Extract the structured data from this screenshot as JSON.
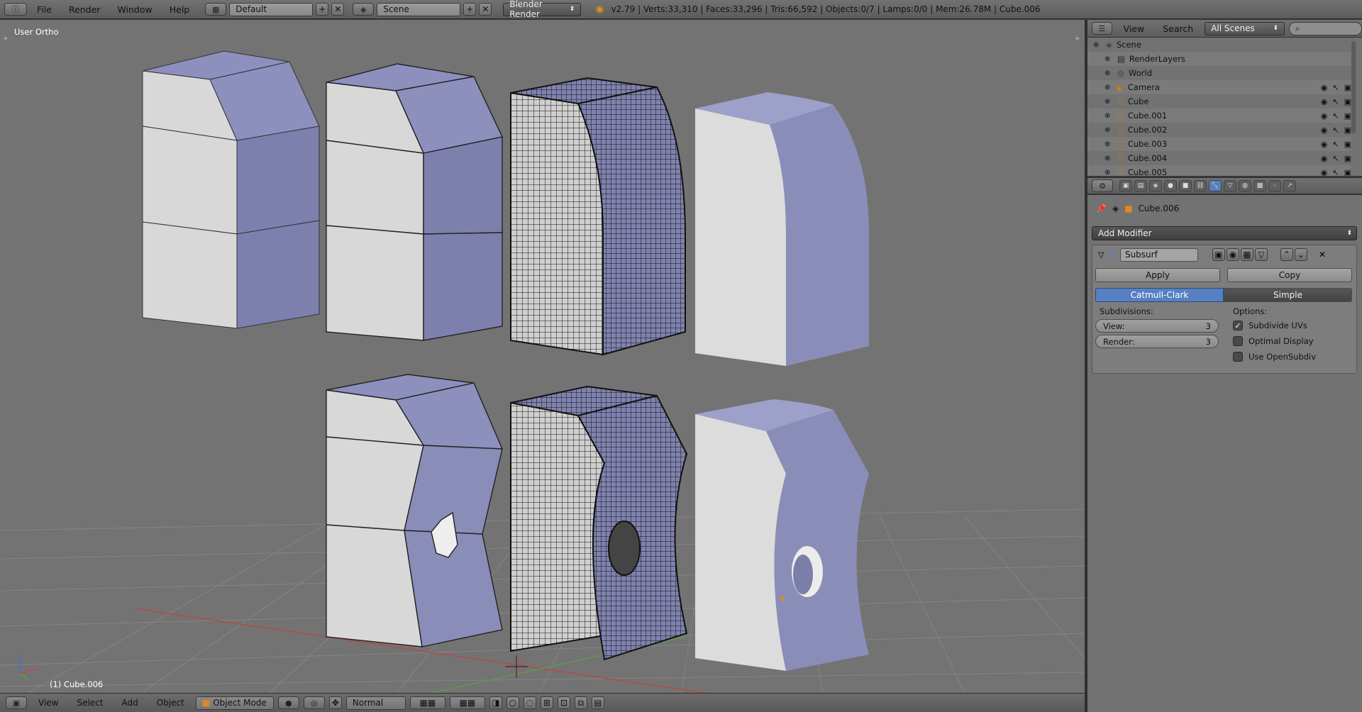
{
  "header": {
    "menus": [
      "File",
      "Render",
      "Window",
      "Help"
    ],
    "layout": "Default",
    "scene": "Scene",
    "engine": "Blender Render",
    "stats": "v2.79 | Verts:33,310 | Faces:33,296 | Tris:66,592 | Objects:0/7 | Lamps:0/0 | Mem:26.78M | Cube.006"
  },
  "viewport": {
    "view_label": "User Ortho",
    "object_label": "(1) Cube.006",
    "colors": {
      "background": "#737373",
      "mesh_light": "#dcdcdc",
      "mesh_dark": "#8c8fb8",
      "grid": "#8a8a8a",
      "x_axis": "#b44a4a",
      "y_axis": "#5e9a4e"
    }
  },
  "viewport_footer": {
    "menus": [
      "View",
      "Select",
      "Add",
      "Object"
    ],
    "mode": "Object Mode",
    "orientation": "Normal"
  },
  "outliner": {
    "menus": [
      "View",
      "Search"
    ],
    "filter": "All Scenes",
    "search_placeholder": "",
    "items": [
      {
        "name": "Scene",
        "icon": "scene-icon"
      },
      {
        "name": "RenderLayers",
        "icon": "renderlayers-icon"
      },
      {
        "name": "World",
        "icon": "world-icon"
      },
      {
        "name": "Camera",
        "icon": "camera-icon"
      },
      {
        "name": "Cube",
        "icon": "mesh-icon"
      },
      {
        "name": "Cube.001",
        "icon": "mesh-icon"
      },
      {
        "name": "Cube.002",
        "icon": "mesh-icon"
      },
      {
        "name": "Cube.003",
        "icon": "mesh-icon"
      },
      {
        "name": "Cube.004",
        "icon": "mesh-icon"
      },
      {
        "name": "Cube.005",
        "icon": "mesh-icon"
      }
    ]
  },
  "properties": {
    "object": "Cube.006",
    "add_modifier": "Add Modifier",
    "modifier": {
      "name": "Subsurf",
      "apply": "Apply",
      "copy": "Copy",
      "type_a": "Catmull-Clark",
      "type_b": "Simple",
      "subdivisions_label": "Subdivisions:",
      "options_label": "Options:",
      "view_label": "View:",
      "view_value": "3",
      "render_label": "Render:",
      "render_value": "3",
      "subdivide_uvs": "Subdivide UVs",
      "optimal_display": "Optimal Display",
      "use_opensubdiv": "Use OpenSubdiv",
      "subdivide_uvs_checked": true,
      "optimal_display_checked": false,
      "use_opensubdiv_checked": false
    }
  }
}
